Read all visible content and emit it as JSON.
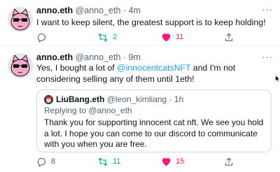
{
  "tweets": [
    {
      "name": "anno.eth",
      "handle": "@anno_eth",
      "time": "4m",
      "text": "I want to keep silent, the greatest support is to keep holding!",
      "reply_count": "",
      "retweet_count": "2",
      "like_count": "11",
      "liked": true,
      "retweeted": false
    },
    {
      "name": "anno.eth",
      "handle": "@anno_eth",
      "time": "9m",
      "text_before": "Yes, I bought a lot of ",
      "mention": "@innocentcatsNFT",
      "text_after": "  and I'm not considering selling any of them until 1eth!",
      "reply_count": "8",
      "retweet_count": "11",
      "like_count": "15",
      "liked": true,
      "retweeted": false,
      "quote": {
        "name": "LiuBang.eth",
        "handle": "@leon_kimliang",
        "time": "1h",
        "replying_to": "Replying to @anno_eth",
        "text": "Thank you for supporting innocent cat nft. We see you hold a lot. I hope you can come to our discord to communicate with you when you are free."
      }
    }
  ],
  "ui": {
    "separator": "·",
    "more_glyph": "···"
  },
  "colors": {
    "link": "#1d9bf0",
    "retweet": "#00ba7c",
    "like": "#f91880",
    "muted": "#536471",
    "avatar_cat": "#f7a9c8"
  },
  "icons": {
    "reply": "reply-icon",
    "retweet": "retweet-icon",
    "like": "heart-icon",
    "share": "share-icon",
    "more": "more-icon"
  }
}
